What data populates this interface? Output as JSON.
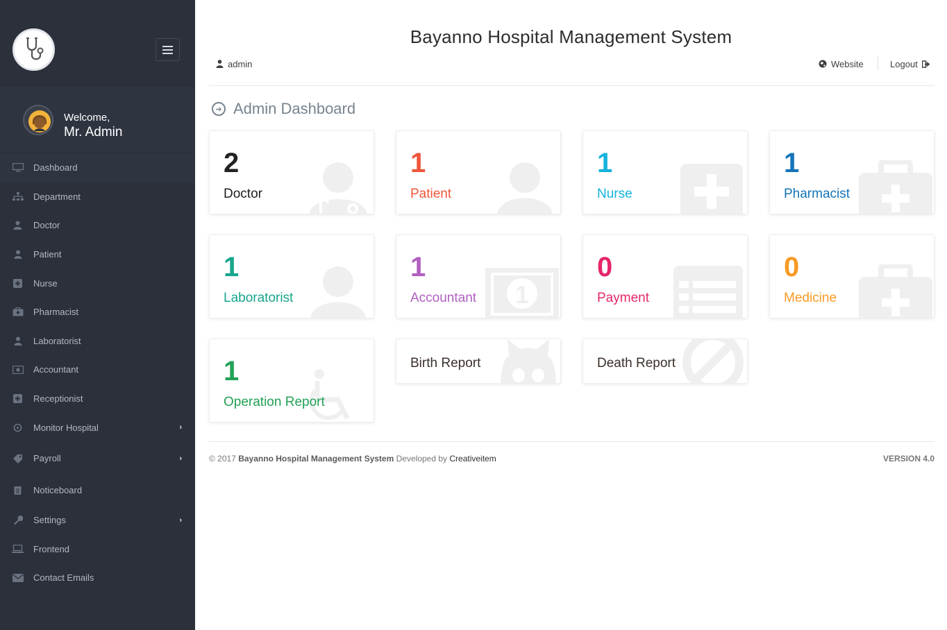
{
  "app": {
    "title": "Bayanno Hospital Management System"
  },
  "header": {
    "user_label": "admin",
    "website_label": "Website",
    "logout_label": "Logout"
  },
  "sidebar": {
    "welcome": "Welcome,",
    "user_name": "Mr. Admin",
    "items": [
      {
        "label": "Dashboard",
        "icon": "desktop-icon",
        "active": true
      },
      {
        "label": "Department",
        "icon": "sitemap-icon"
      },
      {
        "label": "Doctor",
        "icon": "user-md-icon"
      },
      {
        "label": "Patient",
        "icon": "user-icon"
      },
      {
        "label": "Nurse",
        "icon": "plus-square-icon"
      },
      {
        "label": "Pharmacist",
        "icon": "medkit-icon"
      },
      {
        "label": "Laboratorist",
        "icon": "user-icon"
      },
      {
        "label": "Accountant",
        "icon": "money-icon"
      },
      {
        "label": "Receptionist",
        "icon": "plus-square-icon"
      },
      {
        "label": "Monitor Hospital",
        "icon": "sun-icon",
        "has_children": true
      },
      {
        "label": "Payroll",
        "icon": "tag-icon",
        "has_children": true
      },
      {
        "label": "Noticeboard",
        "icon": "clipboard-icon"
      },
      {
        "label": "Settings",
        "icon": "wrench-icon",
        "has_children": true
      },
      {
        "label": "Frontend",
        "icon": "laptop-icon"
      },
      {
        "label": "Contact Emails",
        "icon": "envelope-icon"
      }
    ]
  },
  "dashboard": {
    "title": "Admin Dashboard",
    "cards": [
      {
        "count": "2",
        "label": "Doctor",
        "color": "#222222",
        "icon": "user-md-icon"
      },
      {
        "count": "1",
        "label": "Patient",
        "color": "#ef553a",
        "icon": "user-icon"
      },
      {
        "count": "1",
        "label": "Nurse",
        "color": "#14b3dc",
        "icon": "plus-square-icon"
      },
      {
        "count": "1",
        "label": "Pharmacist",
        "color": "#1474b7",
        "icon": "medkit-icon"
      },
      {
        "count": "1",
        "label": "Laboratorist",
        "color": "#17a58c",
        "icon": "user-icon"
      },
      {
        "count": "1",
        "label": "Accountant",
        "color": "#b15fc0",
        "icon": "money-icon"
      },
      {
        "count": "0",
        "label": "Payment",
        "color": "#e5266b",
        "icon": "list-alt-icon"
      },
      {
        "count": "0",
        "label": "Medicine",
        "color": "#f79a24",
        "icon": "medkit-icon"
      },
      {
        "count": "1",
        "label": "Operation Report",
        "color": "#22a155",
        "icon": "wheelchair-icon"
      },
      {
        "label": "Birth Report",
        "color": "#3b2f2a",
        "icon": "github-icon"
      },
      {
        "label": "Death Report",
        "color": "#3b2f2a",
        "icon": "ban-icon"
      }
    ]
  },
  "footer": {
    "copyright": "© 2017",
    "system_name": "Bayanno Hospital Management System",
    "developed_by": "Developed by",
    "developer": "Creativeitem",
    "version": "VERSION 4.0"
  }
}
